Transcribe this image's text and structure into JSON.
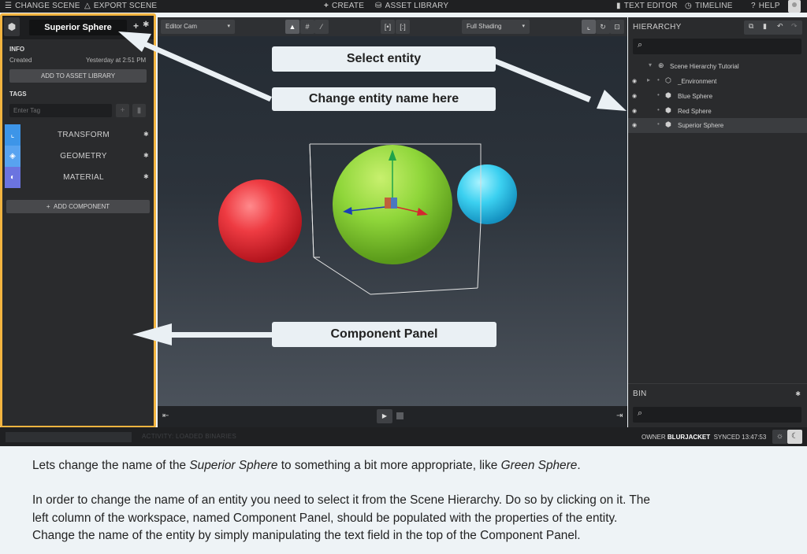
{
  "topbar": {
    "change_scene": "CHANGE SCENE",
    "export_scene": "EXPORT SCENE",
    "create": "CREATE",
    "asset_library": "ASSET LIBRARY",
    "text_editor": "TEXT EDITOR",
    "timeline": "TIMELINE",
    "help": "HELP"
  },
  "component_panel": {
    "entity_name": "Superior Sphere",
    "info_label": "INFO",
    "created_label": "Created",
    "created_value": "Yesterday at 2:51 PM",
    "add_to_asset_library": "ADD TO ASSET LIBRARY",
    "tags_label": "TAGS",
    "tag_placeholder": "Enter Tag",
    "components": [
      {
        "label": "TRANSFORM",
        "color": "#3d95e8",
        "icon": "transform-icon"
      },
      {
        "label": "GEOMETRY",
        "color": "#58a3f0",
        "icon": "geometry-cube-icon"
      },
      {
        "label": "MATERIAL",
        "color": "#6b74e0",
        "icon": "material-sphere-icon"
      }
    ],
    "add_component": "ADD COMPONENT"
  },
  "viewport": {
    "camera": "Editor Cam",
    "shading": "Full Shading"
  },
  "hierarchy": {
    "title": "HIERARCHY",
    "items": [
      {
        "label": "Scene Hierarchy Tutorial",
        "icon": "globe-icon"
      },
      {
        "label": "_Environment",
        "icon": "hexagon-icon"
      },
      {
        "label": "Blue Sphere",
        "icon": "cube-icon"
      },
      {
        "label": "Red Sphere",
        "icon": "cube-icon"
      },
      {
        "label": "Superior Sphere",
        "icon": "cube-icon"
      }
    ],
    "bin_title": "BIN"
  },
  "statusbar": {
    "activity": "ACTIVITY: LOADED BINARIES",
    "owner_label": "OWNER",
    "owner": "BLURJACKET",
    "synced_label": "SYNCED",
    "synced_time": "13:47:53"
  },
  "callouts": {
    "select_entity": "Select entity",
    "change_name": "Change entity name here",
    "component_panel": "Component Panel"
  },
  "instructions": {
    "p1_a": "Lets change the name of the ",
    "p1_em1": "Superior Sphere",
    "p1_b": " to something a bit more appropriate, like ",
    "p1_em2": "Green Sphere",
    "p1_c": ".",
    "p2_line1": "In order to change the name of an entity you need to select it from the Scene Hierarchy. Do so by clicking on it. The",
    "p2_line2": "left column of the workspace, named Component Panel, should be populated with the properties of the entity.",
    "p2_line3": "Change the name of the entity by simply manipulating the text field in the top of the Component Panel."
  },
  "colors": {
    "highlight_border": "#f2b440",
    "red_sphere": "#ee3b42",
    "green_sphere": "#8fd63a",
    "blue_sphere": "#3bd0f0"
  }
}
